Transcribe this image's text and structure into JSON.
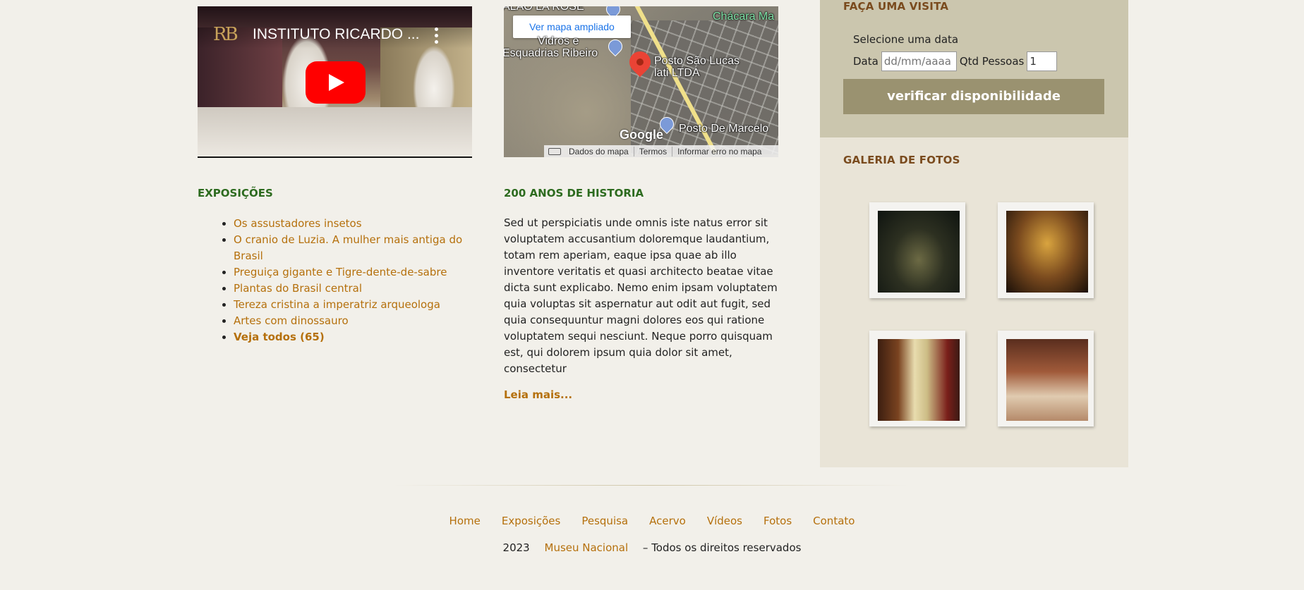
{
  "video": {
    "logo": "RB",
    "title": "INSTITUTO RICARDO ..."
  },
  "map": {
    "enlarge_label": "Ver mapa ampliado",
    "labels": {
      "top_cut": "ALÃO LA ROSE",
      "chacara": "Chácara Ma",
      "vidros": "Vidros e",
      "esquadrias": "Esquadrias Ribeiro",
      "posto1_line1": "Posto São Lucas",
      "posto1_line2": "lati LTDA",
      "posto2": "Posto De Marcelo",
      "google": "Google"
    },
    "attribution": [
      "Dados do mapa",
      "Termos",
      "Informar erro no mapa"
    ]
  },
  "visit": {
    "title": "FAÇA UMA VISITA",
    "select_label": "Selecione uma data",
    "date_label": "Data",
    "date_placeholder": "dd/mm/aaaa",
    "qty_label": "Qtd Pessoas",
    "qty_value": "1",
    "button": "verificar disponibilidade"
  },
  "gallery": {
    "title": "GALERIA DE FOTOS"
  },
  "exposicoes": {
    "title": "EXPOSIÇÕES",
    "items": [
      "Os assustadores insetos",
      "O cranio de Luzia. A mulher mais antiga do Brasil",
      "Preguiça gigante e Tigre-dente-de-sabre",
      "Plantas do Brasil central",
      "Tereza cristina a imperatriz arqueologa",
      "Artes com dinossauro"
    ],
    "see_all": "Veja todos (65)"
  },
  "historia": {
    "title": "200 ANOS DE HISTORIA",
    "text": "Sed ut perspiciatis unde omnis iste natus error sit voluptatem accusantium doloremque laudantium, totam rem aperiam, eaque ipsa quae ab illo inventore veritatis et quasi architecto beatae vitae dicta sunt explicabo. Nemo enim ipsam voluptatem quia voluptas sit aspernatur aut odit aut fugit, sed quia consequuntur magni dolores eos qui ratione voluptatem sequi nesciunt. Neque porro quisquam est, qui dolorem ipsum quia dolor sit amet, consectetur",
    "more": "Leia mais..."
  },
  "footer": {
    "nav": [
      "Home",
      "Exposições",
      "Pesquisa",
      "Acervo",
      "Vídeos",
      "Fotos",
      "Contato"
    ],
    "year": "2023",
    "brand": "Museu Nacional",
    "rights": "– Todos os direitos reservados"
  },
  "colors": {
    "link": "#b5700c",
    "heading_green": "#2d6b1f",
    "heading_brown": "#7a4b1e",
    "button": "#9a9270",
    "visit_bg": "#cbc6ae",
    "side_bg": "#e9e4d7",
    "page_bg": "#f2f0ea"
  }
}
